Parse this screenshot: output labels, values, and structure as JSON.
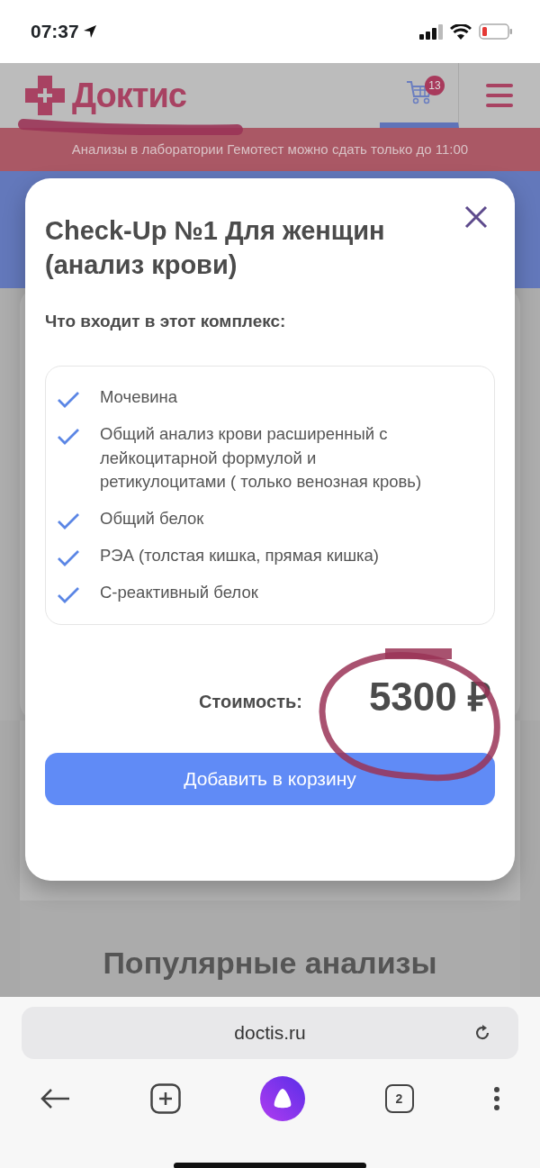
{
  "status_bar": {
    "time": "07:37"
  },
  "site_header": {
    "logo": "Доктис",
    "cart_count": "13",
    "notice": "Анализы в лаборатории Гемотест можно сдать только до 11:00"
  },
  "modal": {
    "title": "Check-Up №1 Для женщин (анализ крови)",
    "subtitle": "Что входит в этот комплекс:",
    "items": [
      {
        "text": "Мочевина",
        "checked": true
      },
      {
        "text": "Общий анализ крови расширенный с лейкоцитарной формулой и ретикулоцитами ( только венозная кровь)",
        "checked": true
      },
      {
        "text": "Общий белок",
        "checked": true
      },
      {
        "text": "РЭА (толстая кишка, прямая кишка)",
        "checked": true
      },
      {
        "text": "С-реактивный белок",
        "checked": true
      }
    ],
    "price_label": "Стоимость:",
    "price": "5300 ₽",
    "button": "Добавить в корзину"
  },
  "background": {
    "heading": "Популярные анализы"
  },
  "browser": {
    "url": "doctis.ru",
    "tab_count": "2"
  }
}
